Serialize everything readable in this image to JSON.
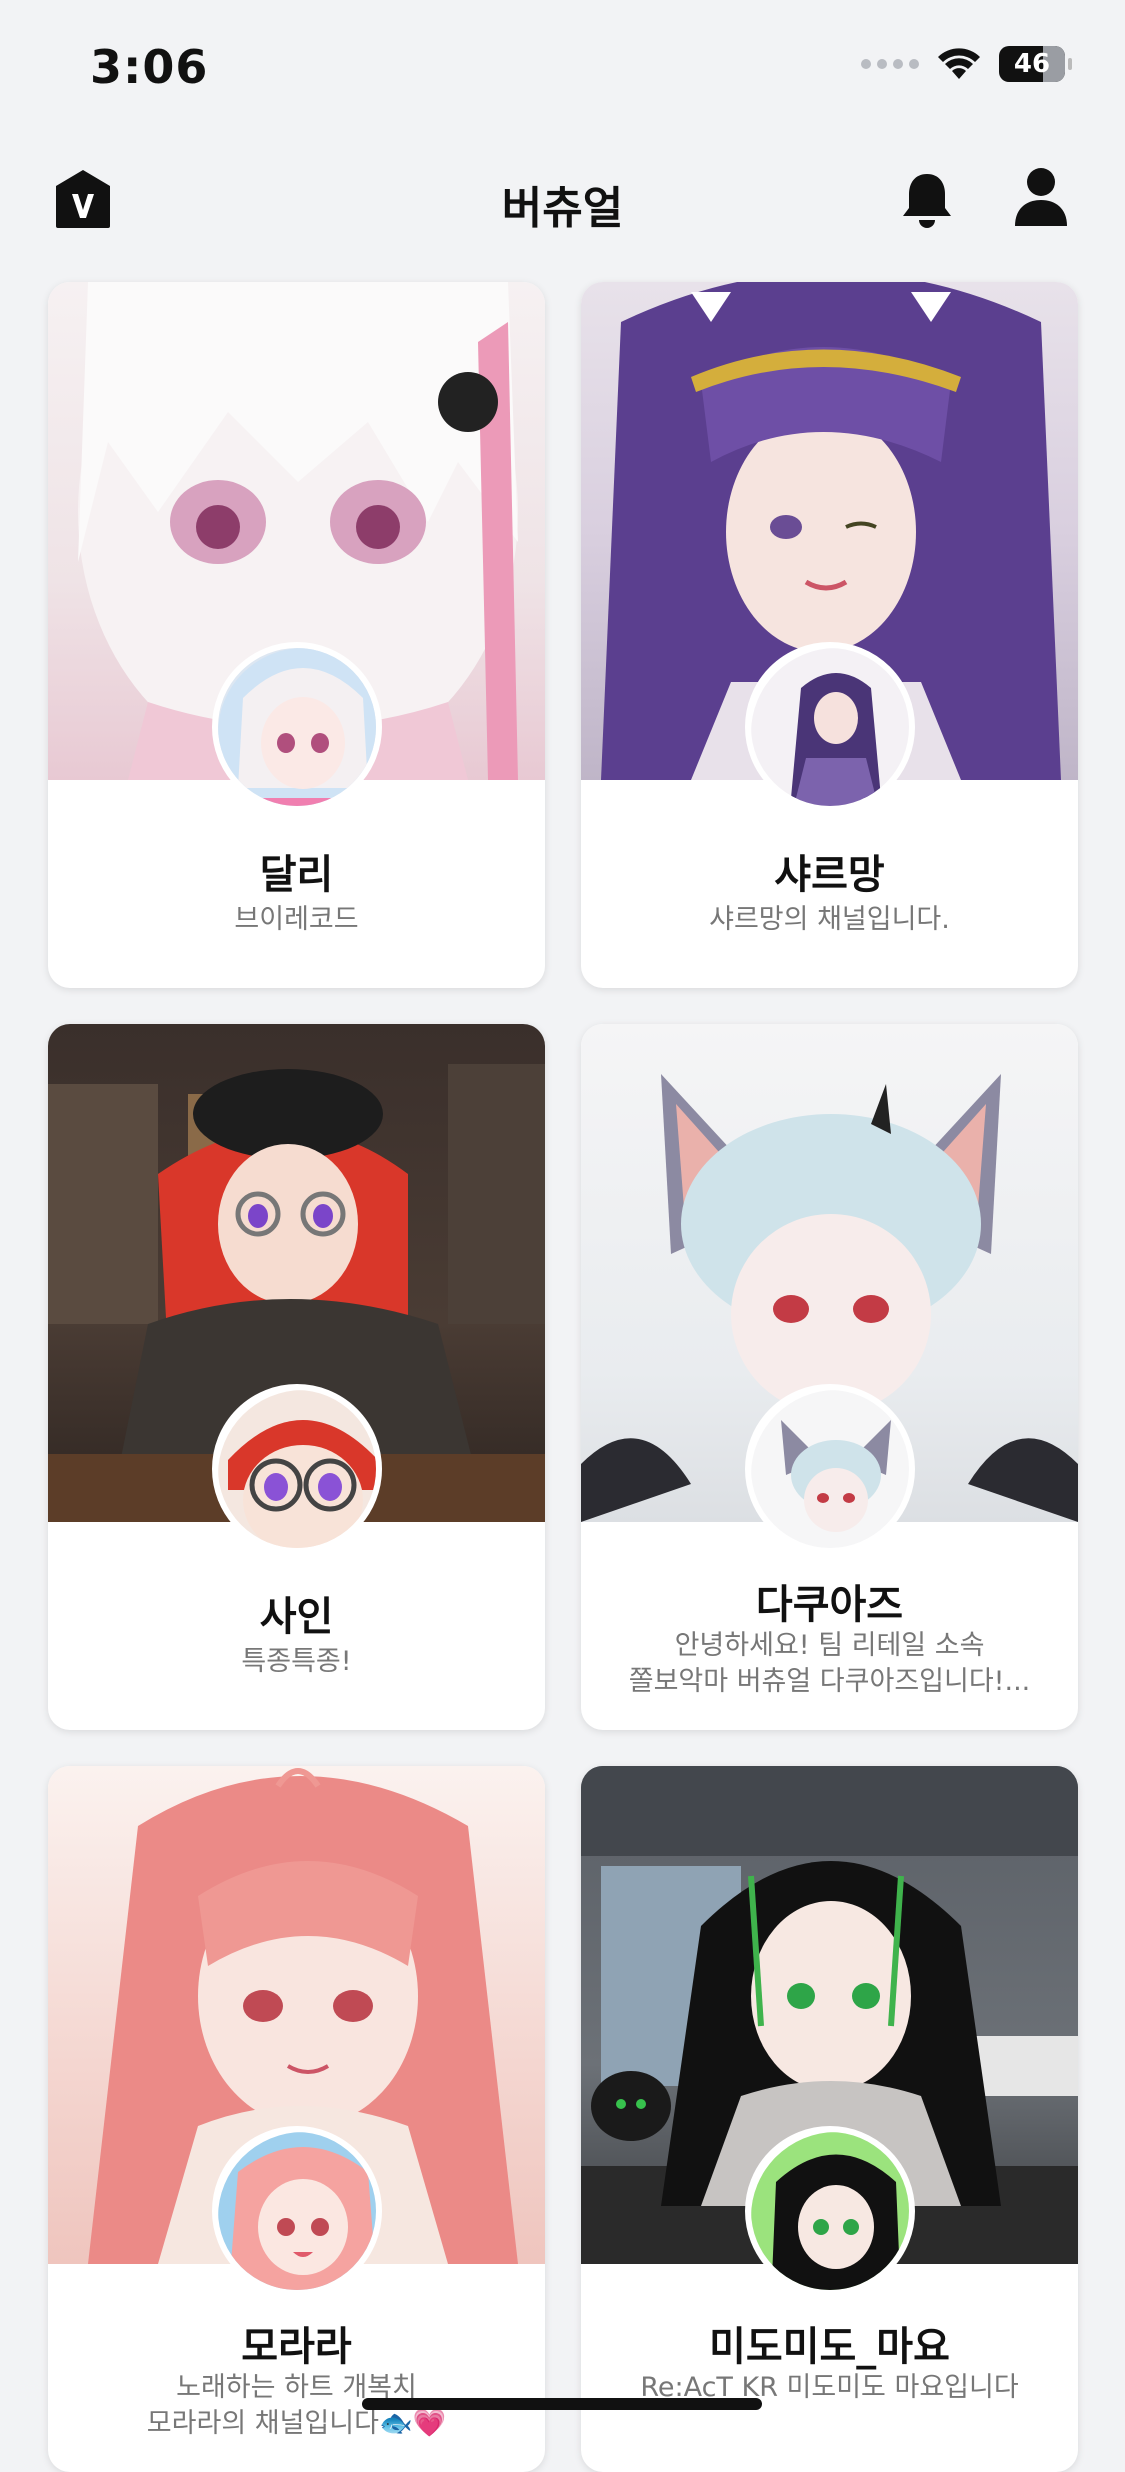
{
  "status_bar": {
    "time": "3:06",
    "battery": "46"
  },
  "header": {
    "title": "버츄얼"
  },
  "cards": [
    {
      "name": "달리",
      "description": "브이레코드",
      "desc_line2": ""
    },
    {
      "name": "샤르망",
      "description": "샤르망의 채널입니다.",
      "desc_line2": ""
    },
    {
      "name": "사인",
      "description": "특종특종!",
      "desc_line2": ""
    },
    {
      "name": "다쿠아즈",
      "description": "안녕하세요! 팀 리테일 소속",
      "desc_line2": "쫄보악마 버츄얼 다쿠아즈입니다!..."
    },
    {
      "name": "모라라",
      "description": "노래하는 하트 개복치",
      "desc_line2": "모라라의 채널입니다🐟💗"
    },
    {
      "name": "미도미도_마요",
      "description": "Re:AcT KR 미도미도 마요입니다",
      "desc_line2": ""
    }
  ],
  "icons": {
    "logo": "v-logo-icon",
    "bell": "bell-icon",
    "user": "user-icon"
  },
  "colors": {
    "background": "#f2f3f5",
    "card": "#ffffff",
    "text_primary": "#111111",
    "text_secondary": "#777777"
  }
}
